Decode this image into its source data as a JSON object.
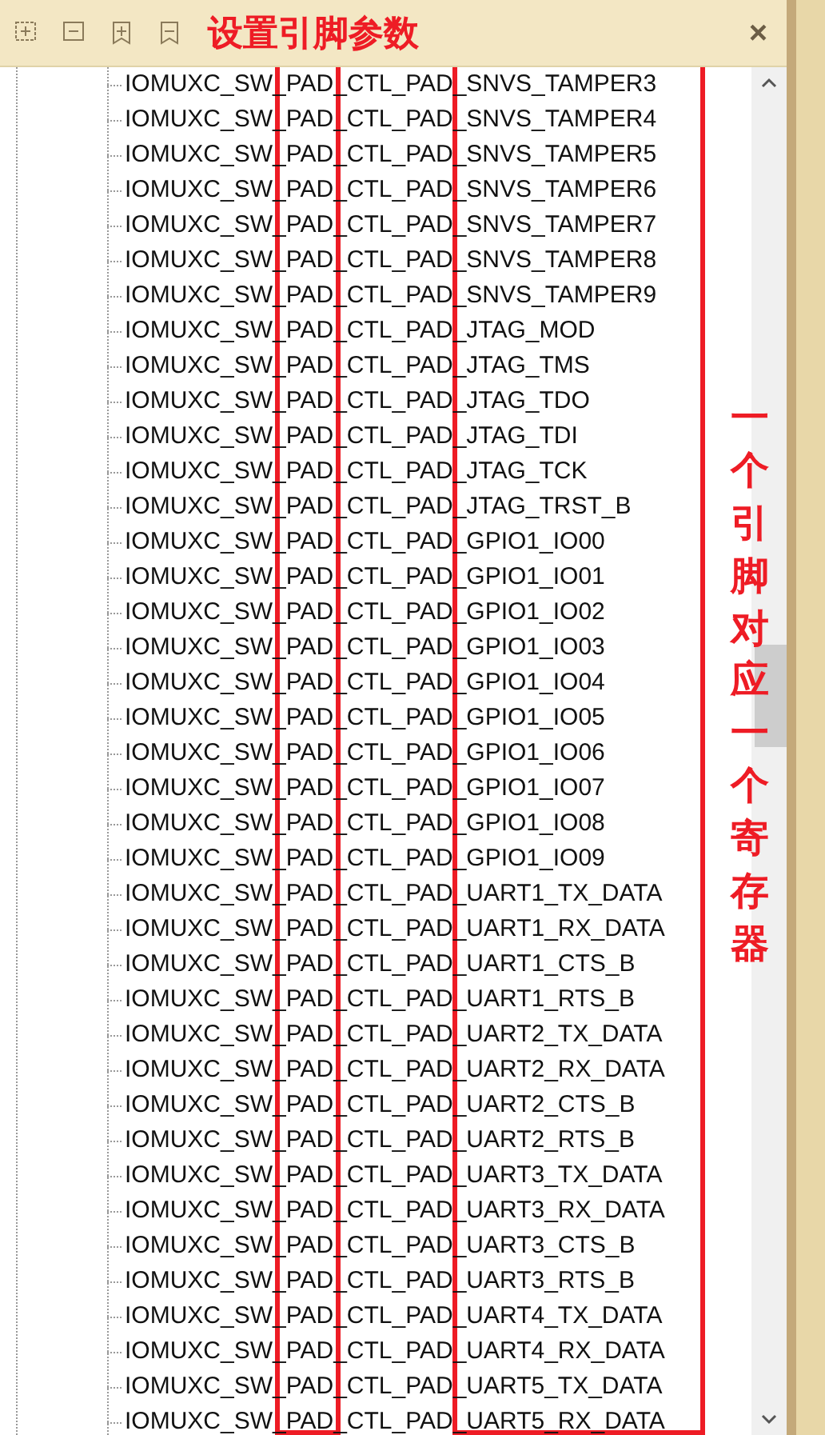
{
  "toolbar": {
    "close": "×"
  },
  "annotations": {
    "title": "设置引脚参数",
    "note": "一个引脚对应一个寄存器"
  },
  "tree": {
    "items": [
      "IOMUXC_SW_PAD_CTL_PAD_SNVS_TAMPER3",
      "IOMUXC_SW_PAD_CTL_PAD_SNVS_TAMPER4",
      "IOMUXC_SW_PAD_CTL_PAD_SNVS_TAMPER5",
      "IOMUXC_SW_PAD_CTL_PAD_SNVS_TAMPER6",
      "IOMUXC_SW_PAD_CTL_PAD_SNVS_TAMPER7",
      "IOMUXC_SW_PAD_CTL_PAD_SNVS_TAMPER8",
      "IOMUXC_SW_PAD_CTL_PAD_SNVS_TAMPER9",
      "IOMUXC_SW_PAD_CTL_PAD_JTAG_MOD",
      "IOMUXC_SW_PAD_CTL_PAD_JTAG_TMS",
      "IOMUXC_SW_PAD_CTL_PAD_JTAG_TDO",
      "IOMUXC_SW_PAD_CTL_PAD_JTAG_TDI",
      "IOMUXC_SW_PAD_CTL_PAD_JTAG_TCK",
      "IOMUXC_SW_PAD_CTL_PAD_JTAG_TRST_B",
      "IOMUXC_SW_PAD_CTL_PAD_GPIO1_IO00",
      "IOMUXC_SW_PAD_CTL_PAD_GPIO1_IO01",
      "IOMUXC_SW_PAD_CTL_PAD_GPIO1_IO02",
      "IOMUXC_SW_PAD_CTL_PAD_GPIO1_IO03",
      "IOMUXC_SW_PAD_CTL_PAD_GPIO1_IO04",
      "IOMUXC_SW_PAD_CTL_PAD_GPIO1_IO05",
      "IOMUXC_SW_PAD_CTL_PAD_GPIO1_IO06",
      "IOMUXC_SW_PAD_CTL_PAD_GPIO1_IO07",
      "IOMUXC_SW_PAD_CTL_PAD_GPIO1_IO08",
      "IOMUXC_SW_PAD_CTL_PAD_GPIO1_IO09",
      "IOMUXC_SW_PAD_CTL_PAD_UART1_TX_DATA",
      "IOMUXC_SW_PAD_CTL_PAD_UART1_RX_DATA",
      "IOMUXC_SW_PAD_CTL_PAD_UART1_CTS_B",
      "IOMUXC_SW_PAD_CTL_PAD_UART1_RTS_B",
      "IOMUXC_SW_PAD_CTL_PAD_UART2_TX_DATA",
      "IOMUXC_SW_PAD_CTL_PAD_UART2_RX_DATA",
      "IOMUXC_SW_PAD_CTL_PAD_UART2_CTS_B",
      "IOMUXC_SW_PAD_CTL_PAD_UART2_RTS_B",
      "IOMUXC_SW_PAD_CTL_PAD_UART3_TX_DATA",
      "IOMUXC_SW_PAD_CTL_PAD_UART3_RX_DATA",
      "IOMUXC_SW_PAD_CTL_PAD_UART3_CTS_B",
      "IOMUXC_SW_PAD_CTL_PAD_UART3_RTS_B",
      "IOMUXC_SW_PAD_CTL_PAD_UART4_TX_DATA",
      "IOMUXC_SW_PAD_CTL_PAD_UART4_RX_DATA",
      "IOMUXC_SW_PAD_CTL_PAD_UART5_TX_DATA",
      "IOMUXC_SW_PAD_CTL_PAD_UART5_RX_DATA"
    ]
  }
}
